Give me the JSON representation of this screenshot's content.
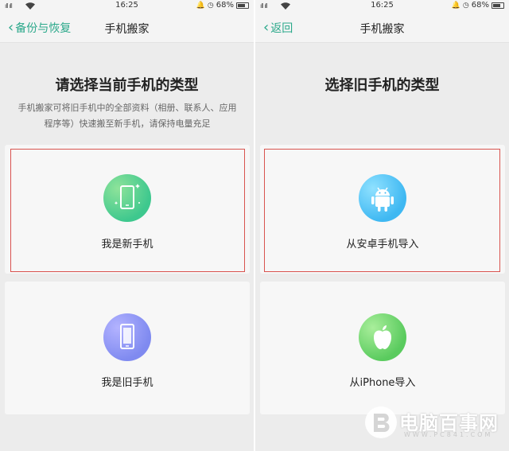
{
  "status_bar": {
    "left": {
      "signal": "ıll ıll",
      "time": "16:25",
      "battery": "68%"
    },
    "right": {
      "signal": "ıll ıll",
      "time": "16:25",
      "battery": "68%"
    }
  },
  "left_screen": {
    "back_label": "备份与恢复",
    "title": "手机搬家",
    "heading": "请选择当前手机的类型",
    "description": "手机搬家可将旧手机中的全部资料（相册、联系人、应用程序等）快速搬至新手机，请保持电量充足",
    "options": [
      {
        "label": "我是新手机",
        "icon": "new-phone-icon",
        "highlighted": true
      },
      {
        "label": "我是旧手机",
        "icon": "old-phone-icon",
        "highlighted": false
      }
    ]
  },
  "right_screen": {
    "back_label": "返回",
    "title": "手机搬家",
    "heading": "选择旧手机的类型",
    "options": [
      {
        "label": "从安卓手机导入",
        "icon": "android-icon",
        "highlighted": true
      },
      {
        "label": "从iPhone导入",
        "icon": "apple-icon",
        "highlighted": false
      }
    ]
  },
  "watermark": {
    "title": "电脑百事网",
    "subtitle": "WWW.PC841.COM"
  },
  "colors": {
    "accent": "#2aa88a",
    "highlight": "#d9534f",
    "green_gradient": "#3ec88e",
    "purple_gradient": "#7f8af0",
    "blue_gradient": "#3fb8f2",
    "apple_green": "#5acb5e"
  }
}
